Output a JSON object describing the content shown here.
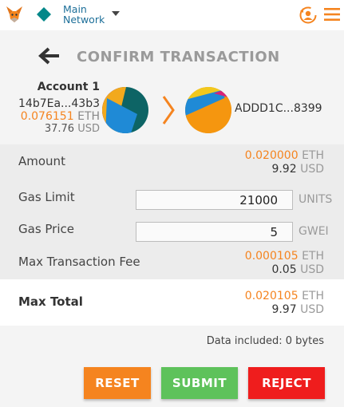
{
  "topbar": {
    "network_line1": "Main",
    "network_line2": "Network",
    "icons": [
      "metamask-fox-icon",
      "network-diamond-icon",
      "chevron-down-icon",
      "account-switch-icon",
      "hamburger-menu-icon"
    ]
  },
  "header": {
    "title": "CONFIRM TRANSACTION"
  },
  "from": {
    "name": "Account 1",
    "address": "14b7Ea...43b3",
    "eth_value": "0.076151",
    "eth_unit": "ETH",
    "usd_value": "37.76",
    "usd_unit": "USD"
  },
  "to": {
    "address": "ADDD1C...8399"
  },
  "details": {
    "amount": {
      "label": "Amount",
      "eth": "0.020000",
      "eth_unit": "ETH",
      "usd": "9.92",
      "usd_unit": "USD"
    },
    "gas_limit": {
      "label": "Gas Limit",
      "value": "21000",
      "unit": "UNITS"
    },
    "gas_price": {
      "label": "Gas Price",
      "value": "5",
      "unit": "GWEI"
    },
    "max_fee": {
      "label": "Max Transaction Fee",
      "eth": "0.000105",
      "eth_unit": "ETH",
      "usd": "0.05",
      "usd_unit": "USD"
    }
  },
  "total": {
    "label": "Max Total",
    "eth": "0.020105",
    "eth_unit": "ETH",
    "usd": "9.97",
    "usd_unit": "USD"
  },
  "data_included": "Data included: 0 bytes",
  "buttons": {
    "reset": "RESET",
    "submit": "SUBMIT",
    "reject": "REJECT"
  },
  "colors": {
    "accent_orange": "#f5841f",
    "submit_green": "#5ec25b",
    "reject_red": "#ef1d1d",
    "network_teal": "#038789",
    "network_text": "#1d6f99"
  }
}
